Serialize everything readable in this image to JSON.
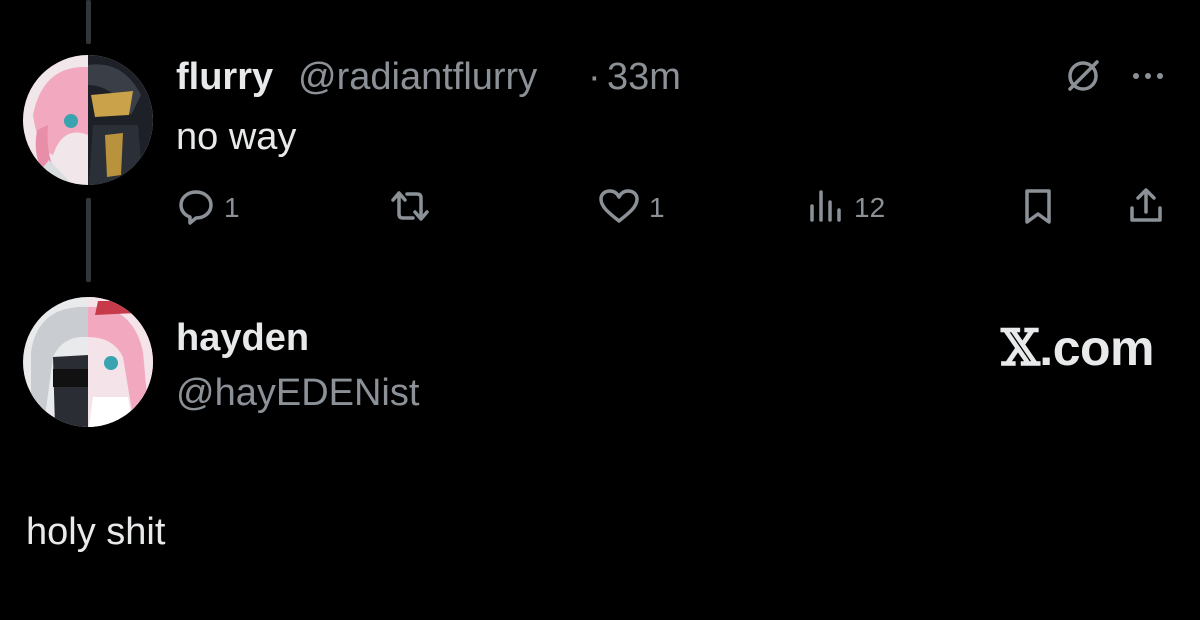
{
  "tweet": {
    "display_name": "flurry",
    "handle": "@radiantflurry",
    "separator": "·",
    "time": "33m",
    "text": "no way",
    "actions": {
      "replies": "1",
      "likes": "1",
      "views": "12"
    },
    "icons": [
      "grok-icon",
      "more-icon",
      "reply-icon",
      "retweet-icon",
      "like-icon",
      "views-icon",
      "bookmark-icon",
      "share-icon"
    ]
  },
  "reply": {
    "display_name": "hayden",
    "handle": "@hayEDENist",
    "text": "holy shit"
  },
  "watermark": {
    "x_letter": "𝕏",
    "domain": ".com"
  },
  "colors": {
    "background": "#000000",
    "text_primary": "#e7e9ea",
    "text_secondary": "#8b9197",
    "thread_line": "#333639"
  }
}
